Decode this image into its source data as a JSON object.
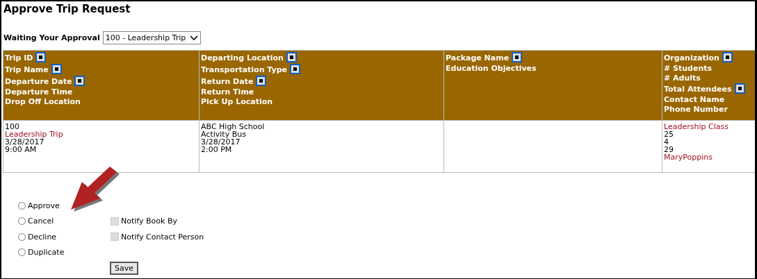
{
  "title": "Approve Trip Request",
  "filter": {
    "label": "Waiting Your Approval",
    "value": "100 - Leadership Trip"
  },
  "table": {
    "columns": [
      {
        "lines": [
          {
            "text": "Trip ID",
            "sortable": true
          },
          {
            "text": "Trip Name",
            "sortable": true
          },
          {
            "text": "Departure Date",
            "sortable": true
          },
          {
            "text": "Departure Time",
            "sortable": false
          },
          {
            "text": "Drop Off Location",
            "sortable": false
          }
        ]
      },
      {
        "lines": [
          {
            "text": "Departing Location",
            "sortable": true
          },
          {
            "text": "Transportation Type",
            "sortable": true
          },
          {
            "text": "Return Date",
            "sortable": true
          },
          {
            "text": "Return Time",
            "sortable": false
          },
          {
            "text": "Pick Up Location",
            "sortable": false
          }
        ]
      },
      {
        "lines": [
          {
            "text": "Package Name",
            "sortable": true
          },
          {
            "text": "Education Objectives",
            "sortable": false
          }
        ]
      },
      {
        "lines": [
          {
            "text": "Organization",
            "sortable": true
          },
          {
            "text": "# Students",
            "sortable": false
          },
          {
            "text": "# Adults",
            "sortable": false
          },
          {
            "text": "Total Attendees",
            "sortable": true
          },
          {
            "text": "Contact Name",
            "sortable": false
          },
          {
            "text": "Phone Number",
            "sortable": false
          }
        ]
      }
    ],
    "rows": [
      {
        "cells": [
          [
            {
              "text": "100",
              "kind": "plain"
            },
            {
              "text": "Leadership Trip",
              "kind": "link"
            },
            {
              "text": "3/28/2017",
              "kind": "plain"
            },
            {
              "text": "9:00 AM",
              "kind": "plain"
            }
          ],
          [
            {
              "text": "ABC High School",
              "kind": "plain"
            },
            {
              "text": "Activity Bus",
              "kind": "plain"
            },
            {
              "text": "3/28/2017",
              "kind": "plain"
            },
            {
              "text": "2:00 PM",
              "kind": "plain"
            }
          ],
          [],
          [
            {
              "text": "Leadership Class",
              "kind": "link"
            },
            {
              "text": "25",
              "kind": "plain"
            },
            {
              "text": "4",
              "kind": "plain"
            },
            {
              "text": "29",
              "kind": "plain"
            },
            {
              "text": "MaryPoppins",
              "kind": "link"
            }
          ]
        ]
      }
    ]
  },
  "actions": [
    {
      "label": "Approve",
      "selected": false
    },
    {
      "label": "Cancel",
      "selected": false
    },
    {
      "label": "Decline",
      "selected": false
    },
    {
      "label": "Duplicate",
      "selected": false
    }
  ],
  "notify": [
    {
      "label": "Notify Book By",
      "checked": false,
      "disabled": true
    },
    {
      "label": "Notify Contact Person",
      "checked": false,
      "disabled": true
    }
  ],
  "save_button": "Save"
}
